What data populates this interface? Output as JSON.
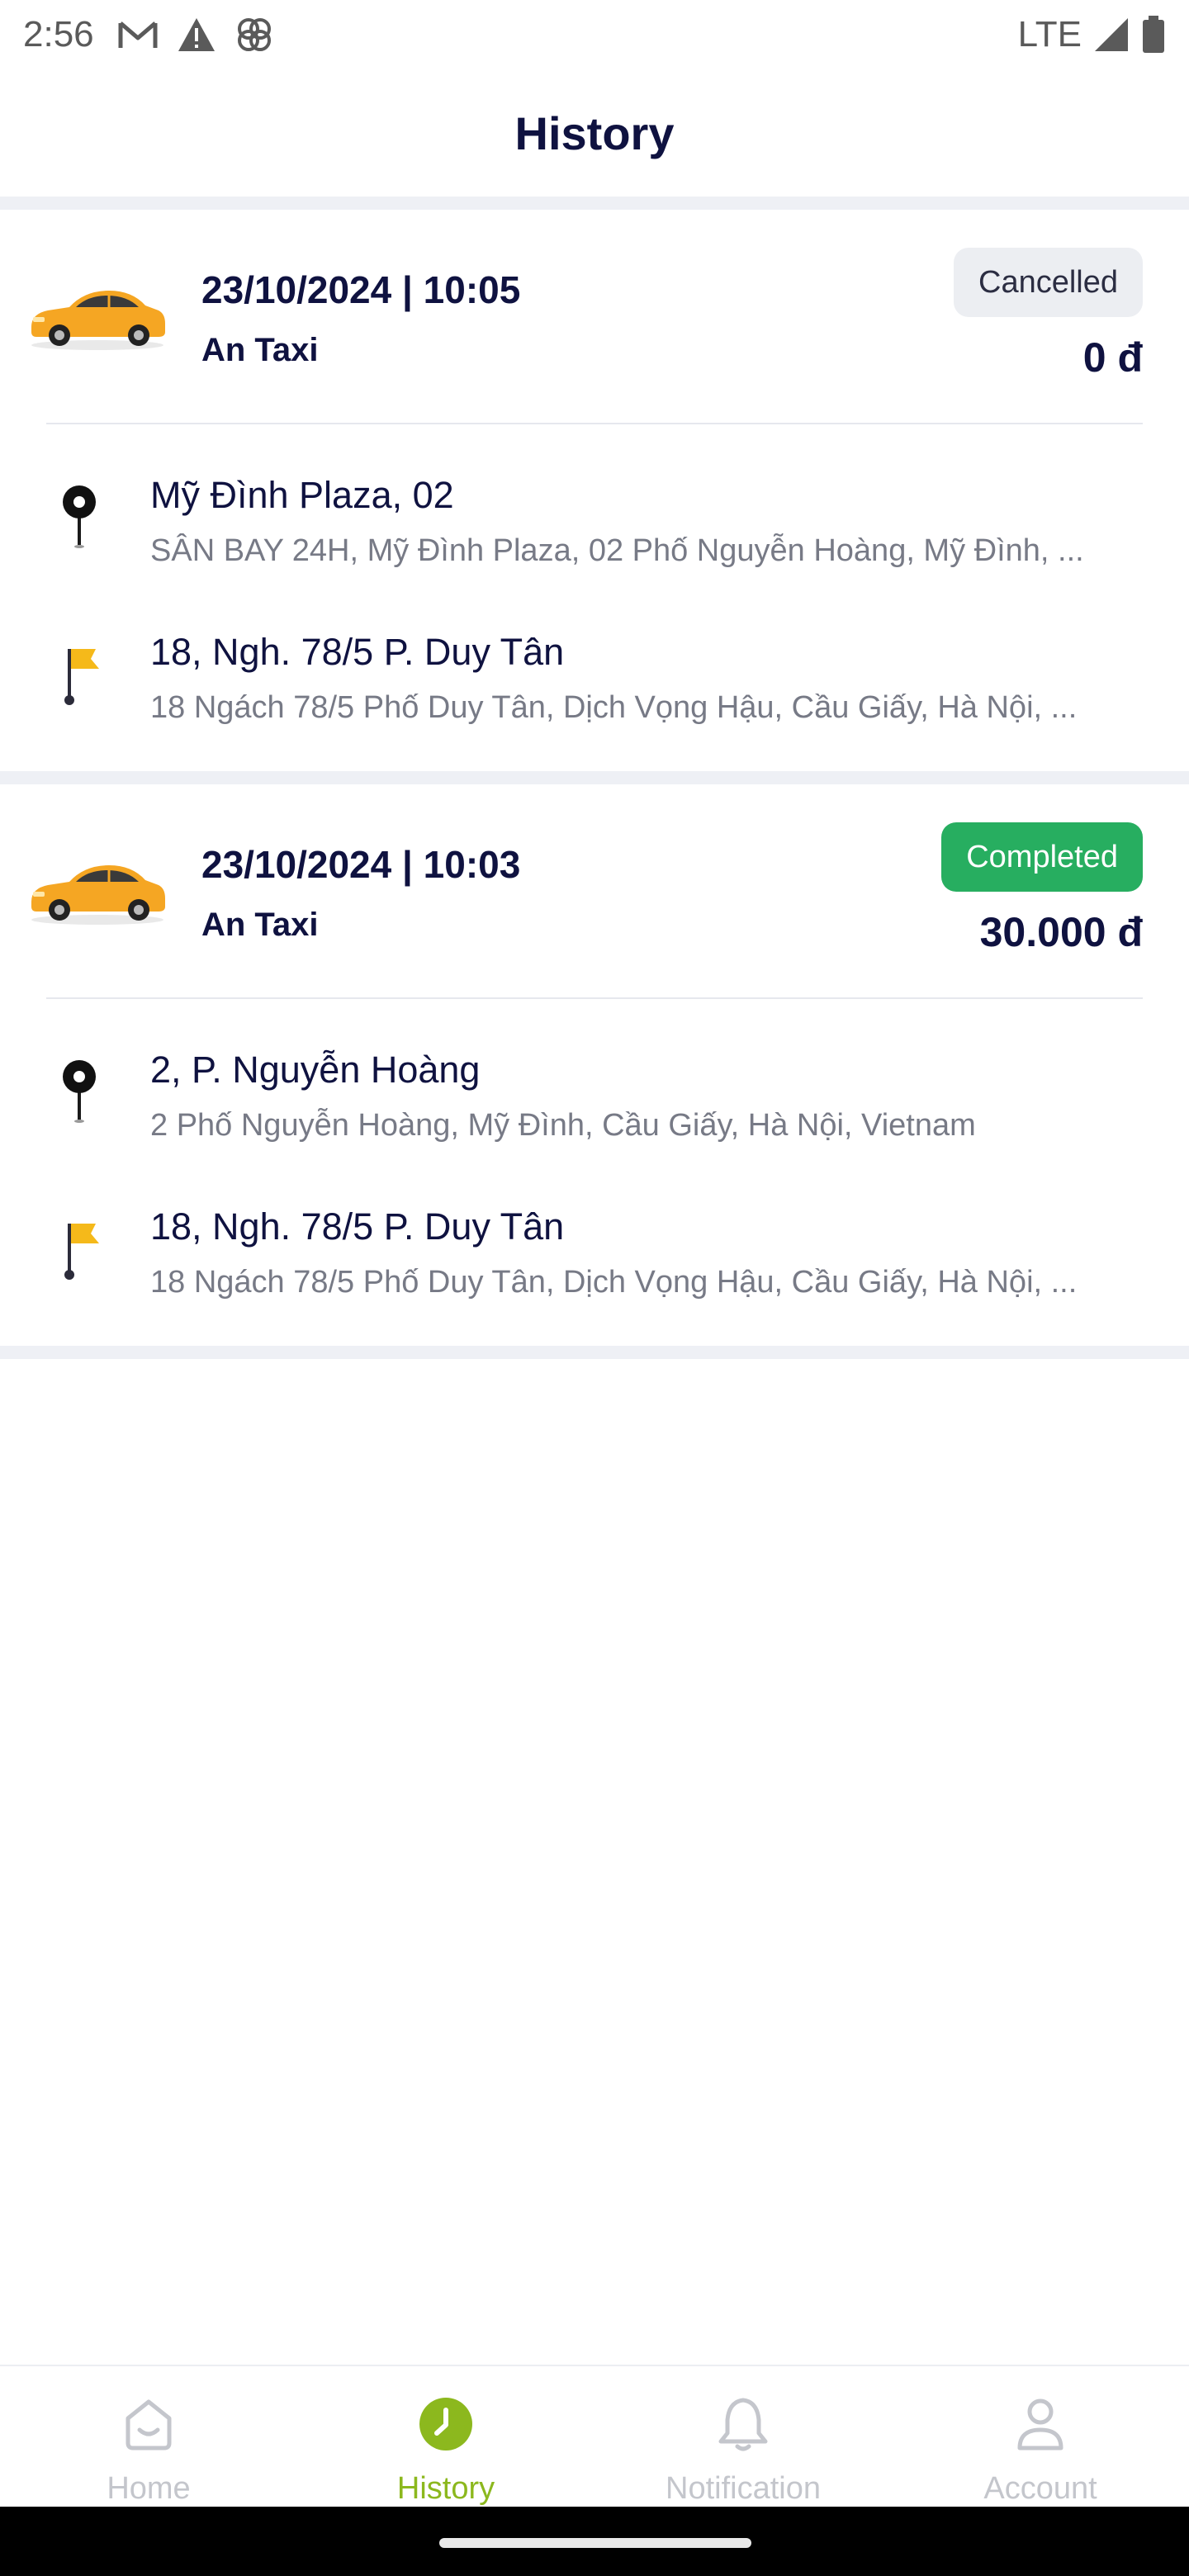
{
  "status_bar": {
    "time": "2:56",
    "network": "LTE",
    "left_icons": [
      "gmail-icon",
      "warning-icon",
      "pinwheel-icon"
    ],
    "right_icons": [
      "signal-icon",
      "battery-icon"
    ]
  },
  "header": {
    "title": "History"
  },
  "trips": [
    {
      "datetime": "23/10/2024 | 10:05",
      "provider": "An Taxi",
      "status": "Cancelled",
      "price": "0 đ",
      "pickup": {
        "name": "Mỹ Đình Plaza, 02",
        "address": "SÂN BAY 24H, Mỹ Đình Plaza, 02 Phố Nguyễn Hoàng, Mỹ Đình, ..."
      },
      "dropoff": {
        "name": "18, Ngh. 78/5 P. Duy Tân",
        "address": "18 Ngách 78/5 Phố Duy Tân, Dịch Vọng Hậu, Cầu Giấy, Hà Nội, ..."
      }
    },
    {
      "datetime": "23/10/2024 | 10:03",
      "provider": "An Taxi",
      "status": "Completed",
      "price": "30.000 đ",
      "pickup": {
        "name": "2, P. Nguyễn Hoàng",
        "address": "2 Phố Nguyễn Hoàng, Mỹ Đình, Cầu Giấy, Hà Nội, Vietnam"
      },
      "dropoff": {
        "name": "18, Ngh. 78/5 P. Duy Tân",
        "address": "18 Ngách 78/5 Phố Duy Tân, Dịch Vọng Hậu, Cầu Giấy, Hà Nội, ..."
      }
    }
  ],
  "bottom_nav": {
    "items": [
      {
        "label": "Home",
        "icon": "home-icon",
        "active": false
      },
      {
        "label": "History",
        "icon": "clock-icon",
        "active": true
      },
      {
        "label": "Notification",
        "icon": "bell-icon",
        "active": false
      },
      {
        "label": "Account",
        "icon": "user-icon",
        "active": false
      }
    ]
  },
  "colors": {
    "primary_text": "#0f1240",
    "active_nav": "#8cb81e",
    "completed_badge": "#27ae60",
    "cancelled_badge": "#eceef2",
    "car_body": "#f5a623"
  }
}
